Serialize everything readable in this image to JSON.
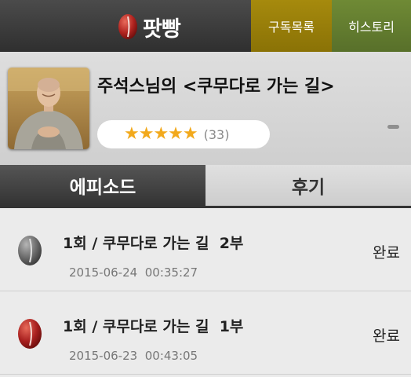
{
  "header": {
    "app_name": "팟빵",
    "subscriptions_label": "구독목록",
    "history_label": "히스토리",
    "logo_icon": "red-bean-icon"
  },
  "program": {
    "title": "주석스님의 <쿠무다로 가는 길>",
    "stars": "★★★★★",
    "rating_count": "(33)"
  },
  "tabs": {
    "episodes": "에피소드",
    "reviews": "후기"
  },
  "episodes": [
    {
      "title": "1회 / 쿠무다로 가는 길  2부",
      "date": "2015-06-24",
      "duration": "00:35:27",
      "status": "완료",
      "icon": "gray-bean-icon"
    },
    {
      "title": "1회 / 쿠무다로 가는 길  1부",
      "date": "2015-06-23",
      "duration": "00:43:05",
      "status": "완료",
      "icon": "red-bean-icon"
    }
  ],
  "colors": {
    "subscriptions_bg": "#9a800b",
    "history_bg": "#647d30",
    "star": "#f2a91c",
    "bean_red": "#a8201f",
    "bean_gray": "#6a6a6a"
  }
}
